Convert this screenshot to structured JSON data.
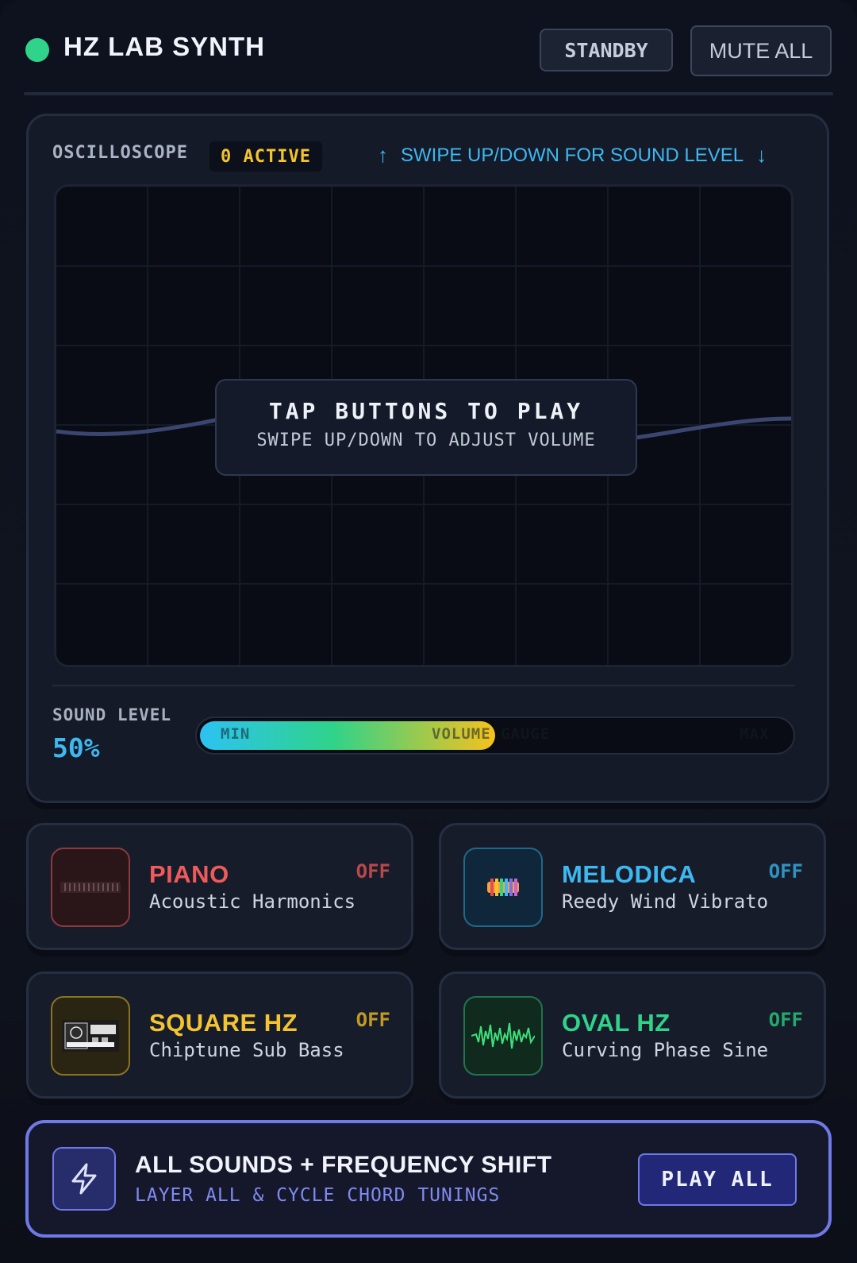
{
  "header": {
    "title": "HZ LAB SYNTH",
    "standby_label": "STANDBY",
    "mute_label": "MUTE ALL",
    "status_color": "#2fd38a"
  },
  "scope": {
    "label": "OSCILLOSCOPE",
    "active_badge": "0 ACTIVE",
    "hint": "SWIPE UP/DOWN FOR SOUND LEVEL",
    "hint_icons": [
      "arrow-up-icon",
      "arrow-down-icon"
    ],
    "overlay_title": "TAP BUTTONS TO PLAY",
    "overlay_subtitle": "SWIPE UP/DOWN TO ADJUST VOLUME"
  },
  "sound_level": {
    "label": "SOUND LEVEL",
    "value_text": "50%",
    "value_fraction": 0.5,
    "gauge_labels": {
      "min": "MIN",
      "center": "VOLUME GAUGE",
      "max": "MAX"
    }
  },
  "sounds": [
    {
      "name": "PIANO",
      "description": "Acoustic Harmonics",
      "state": "OFF",
      "color": "#ef5a5a",
      "icon": "piano-keys-icon"
    },
    {
      "name": "MELODICA",
      "description": "Reedy Wind Vibrato",
      "state": "OFF",
      "color": "#3db8f0",
      "icon": "melodica-icon"
    },
    {
      "name": "SQUARE HZ",
      "description": "Chiptune Sub Bass",
      "state": "OFF",
      "color": "#f4c430",
      "icon": "square-wave-device-icon"
    },
    {
      "name": "OVAL HZ",
      "description": "Curving Phase Sine",
      "state": "OFF",
      "color": "#2fd38a",
      "icon": "waveform-icon"
    }
  ],
  "play_all": {
    "title": "ALL SOUNDS + FREQUENCY SHIFT",
    "subtitle": "LAYER ALL & CYCLE CHORD TUNINGS",
    "button_label": "PLAY ALL",
    "icon": "lightning-bolt-icon",
    "accent": "#6f79e8"
  }
}
